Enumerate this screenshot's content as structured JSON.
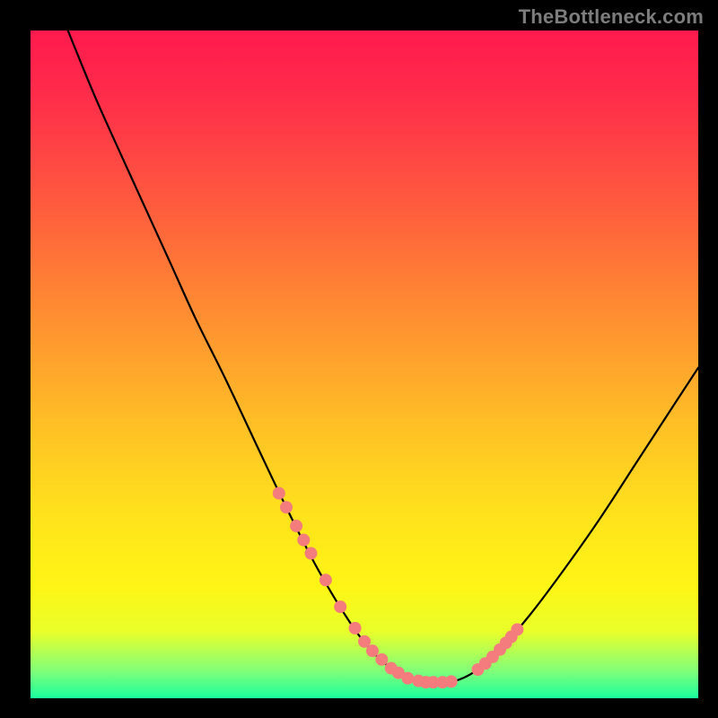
{
  "watermark": "TheBottleneck.com",
  "colors": {
    "page_bg": "#000000",
    "gradient_top": "#ff1a4e",
    "gradient_bottom": "#19ff9d",
    "curve": "#000000",
    "marker": "#f47c7c",
    "watermark_text": "#7d7d7d"
  },
  "chart_data": {
    "type": "line",
    "title": "",
    "xlabel": "",
    "ylabel": "",
    "xlim": [
      0,
      100
    ],
    "ylim": [
      0,
      100
    ],
    "grid": false,
    "note": "Axis values are estimated from pixel position; no numeric tick labels are shown on the image. y represents bottleneck percentage (100 = red/top, 0 = green/bottom). x represents a hardware range.",
    "series": [
      {
        "name": "bottleneck-curve",
        "x": [
          5.6,
          9.7,
          14.6,
          20.8,
          24.7,
          29.3,
          34.1,
          38.3,
          42.5,
          46.9,
          50.7,
          54.6,
          58.6,
          62.8,
          66.4,
          70.2,
          74.8,
          79.7,
          85.2,
          91.0,
          96.4,
          100.0
        ],
        "y": [
          100.0,
          90.0,
          79.1,
          65.5,
          56.9,
          47.6,
          37.4,
          28.6,
          20.3,
          12.8,
          7.5,
          4.1,
          2.4,
          2.4,
          3.9,
          7.2,
          12.5,
          19.0,
          26.8,
          35.7,
          44.0,
          49.5
        ]
      }
    ],
    "markers": {
      "name": "highlighted-points",
      "note": "Dots drawn on the curve near the valley/floor region, color #f47c7c.",
      "x": [
        37.2,
        38.3,
        39.8,
        40.9,
        42.0,
        44.2,
        46.4,
        48.6,
        50.0,
        51.2,
        52.6,
        54.0,
        55.1,
        56.5,
        58.1,
        59.2,
        60.3,
        61.7,
        63.0,
        67.0,
        68.1,
        69.2,
        70.3,
        71.2,
        72.0,
        72.9
      ],
      "y": [
        30.7,
        28.6,
        25.8,
        23.7,
        21.7,
        17.7,
        13.7,
        10.5,
        8.5,
        7.1,
        5.8,
        4.5,
        3.8,
        3.0,
        2.6,
        2.4,
        2.4,
        2.4,
        2.5,
        4.3,
        5.2,
        6.2,
        7.3,
        8.3,
        9.2,
        10.3
      ]
    }
  }
}
